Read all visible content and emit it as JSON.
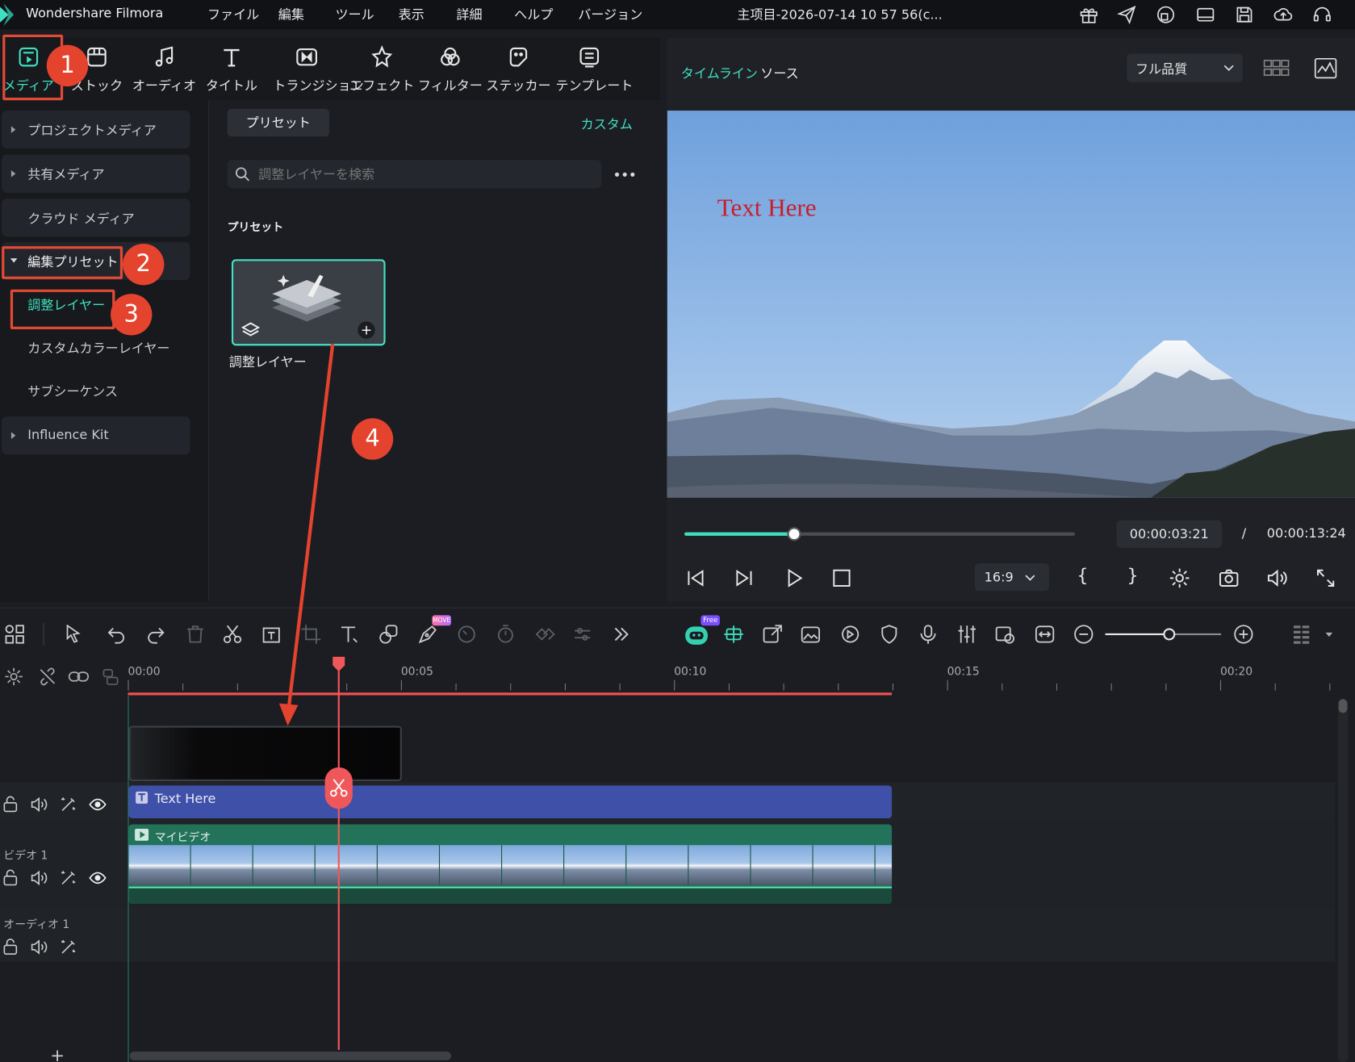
{
  "titlebar": {
    "app_name": "Wondershare Filmora",
    "menu": [
      "ファイル",
      "編集",
      "ツール",
      "表示",
      "詳細",
      "ヘルプ",
      "バージョン"
    ],
    "project_title": "主项目-2026-07-14 10 57 56(c...",
    "icons": [
      "gift-icon",
      "send-icon",
      "cloud-sync-icon",
      "layout-icon",
      "save-icon",
      "cloud-upload-icon",
      "headset-icon"
    ]
  },
  "tabs": [
    {
      "label": "メディア",
      "icon": "media-icon",
      "active": true
    },
    {
      "label": "ストック",
      "icon": "stock-icon"
    },
    {
      "label": "オーディオ",
      "icon": "music-note-icon"
    },
    {
      "label": "タイトル",
      "icon": "title-t-icon"
    },
    {
      "label": "トランジション",
      "icon": "transition-icon"
    },
    {
      "label": "エフェクト",
      "icon": "effects-star-icon"
    },
    {
      "label": "フィルター",
      "icon": "filter-icon"
    },
    {
      "label": "ステッカー",
      "icon": "sticker-icon"
    },
    {
      "label": "テンプレート",
      "icon": "template-icon"
    }
  ],
  "sidebar": {
    "items": [
      {
        "label": "プロジェクトメディア"
      },
      {
        "label": "共有メディア"
      },
      {
        "label": "クラウド メディア"
      },
      {
        "label": "編集プリセット"
      },
      {
        "label": "調整レイヤー"
      },
      {
        "label": "カスタムカラーレイヤー"
      },
      {
        "label": "サブシーケンス"
      },
      {
        "label": "Influence Kit"
      }
    ]
  },
  "content": {
    "tab_preset": "プリセット",
    "tab_custom": "カスタム",
    "search_placeholder": "調整レイヤーを検索",
    "section_title": "プリセット",
    "card_label": "調整レイヤー"
  },
  "preview": {
    "tab_timeline": "タイムライン",
    "tab_source": "ソース",
    "quality": "フル品質",
    "overlay_text": "Text Here",
    "current_time": "00:00:03:21",
    "separator": "/",
    "total_time": "00:00:13:24",
    "progress": 0.28,
    "aspect": "16:9",
    "bracket_in": "{",
    "bracket_out": "}"
  },
  "timeline": {
    "badges": {
      "ai": "Free",
      "move": "MOVE"
    },
    "ruler_labels": [
      "00:00",
      "00:05",
      "00:10",
      "00:15",
      "00:20"
    ],
    "title_clip": "Text Here",
    "video_clip": "マイビデオ",
    "track_video": "ビデオ 1",
    "track_audio": "オーディオ 1",
    "zoom_level": 0.55,
    "add_track": "+"
  },
  "annotations": [
    "1",
    "2",
    "3",
    "4"
  ],
  "colors": {
    "accent": "#3fe0c0",
    "annotation": "#e4432e",
    "playhead": "#f0575a",
    "title_clip": "#3e50a8",
    "video_clip": "#23725a"
  }
}
